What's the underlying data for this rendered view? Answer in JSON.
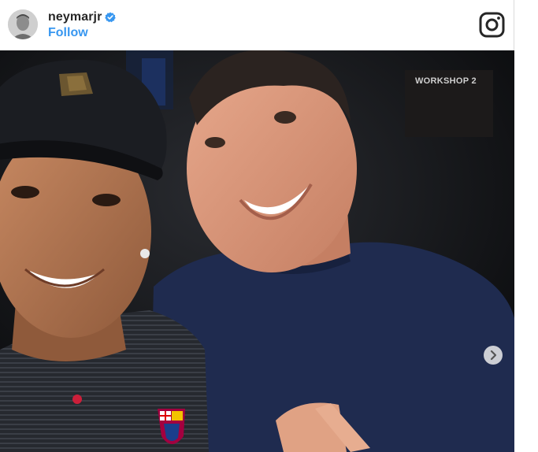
{
  "header": {
    "username": "neymarjr",
    "verified": true,
    "follow_label": "Follow",
    "logo_icon": "instagram-icon"
  },
  "photo": {
    "sign_text": "WORKSHOP 2",
    "next_icon": "chevron-right-icon"
  },
  "colors": {
    "link": "#3897f0",
    "verified": "#3897f0",
    "text": "#262626"
  }
}
